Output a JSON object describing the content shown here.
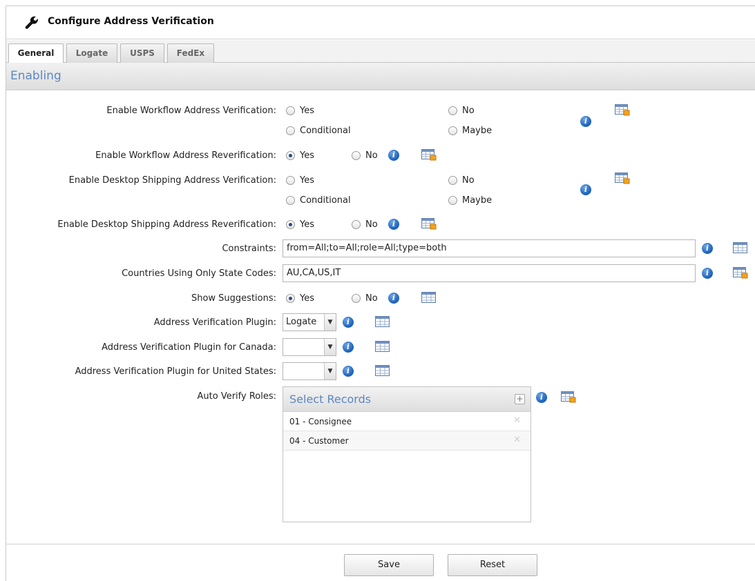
{
  "window": {
    "title": "Configure Address Verification"
  },
  "tabs": [
    {
      "label": "General",
      "active": true
    },
    {
      "label": "Logate",
      "active": false
    },
    {
      "label": "USPS",
      "active": false
    },
    {
      "label": "FedEx",
      "active": false
    }
  ],
  "section": {
    "title": "Enabling"
  },
  "fields": {
    "workflow_verification": {
      "label": "Enable Workflow Address Verification:",
      "options": [
        "Yes",
        "No",
        "Conditional",
        "Maybe"
      ],
      "selected": ""
    },
    "workflow_reverification": {
      "label": "Enable Workflow Address Reverification:",
      "options": [
        "Yes",
        "No"
      ],
      "selected": "Yes"
    },
    "desktop_verification": {
      "label": "Enable Desktop Shipping Address Verification:",
      "options": [
        "Yes",
        "No",
        "Conditional",
        "Maybe"
      ],
      "selected": ""
    },
    "desktop_reverification": {
      "label": "Enable Desktop Shipping Address Reverification:",
      "options": [
        "Yes",
        "No"
      ],
      "selected": "Yes"
    },
    "constraints": {
      "label": "Constraints:",
      "value": "from=All;to=All;role=All;type=both"
    },
    "state_codes": {
      "label": "Countries Using Only State Codes:",
      "value": "AU,CA,US,IT"
    },
    "show_suggestions": {
      "label": "Show Suggestions:",
      "options": [
        "Yes",
        "No"
      ],
      "selected": "Yes"
    },
    "plugin": {
      "label": "Address Verification Plugin:",
      "value": "Logate"
    },
    "plugin_canada": {
      "label": "Address Verification Plugin for Canada:",
      "value": ""
    },
    "plugin_us": {
      "label": "Address Verification Plugin for United States:",
      "value": ""
    },
    "auto_verify_roles": {
      "label": "Auto Verify Roles:",
      "panel_title": "Select Records",
      "records": [
        "01 - Consignee",
        "04 - Customer"
      ]
    }
  },
  "buttons": {
    "save": "Save",
    "reset": "Reset"
  },
  "icons": {
    "title": "wrench-icon",
    "info": "info-icon",
    "table": "table-icon",
    "add": "plus-icon",
    "remove": "close-icon"
  },
  "colors": {
    "section_title": "#5c87c2",
    "info_blue": "#1a5fb6"
  }
}
